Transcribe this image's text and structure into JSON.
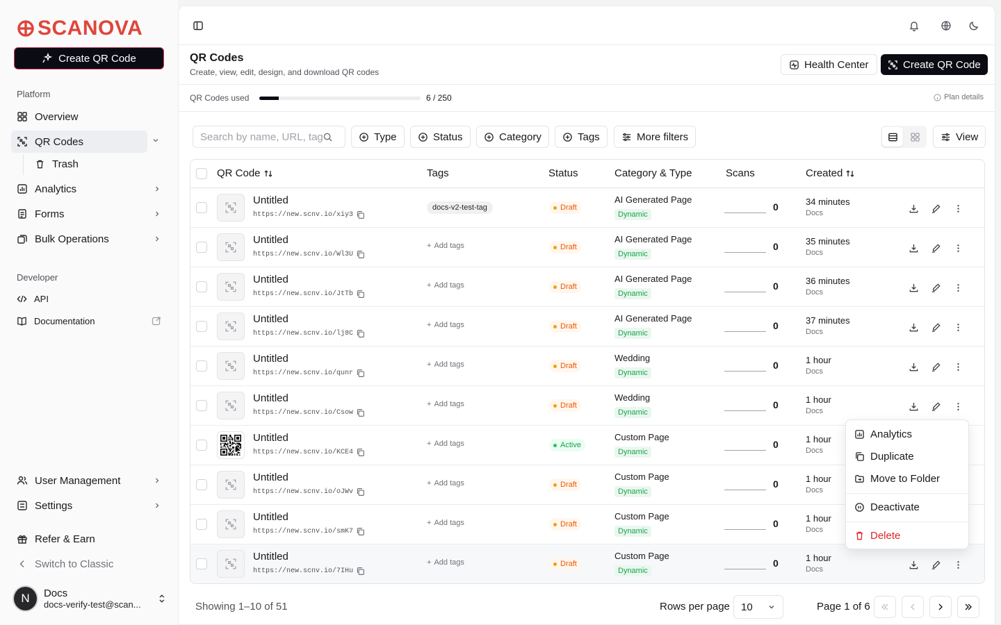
{
  "brand": {
    "name": "SCANOVA",
    "accent": "#e0453a"
  },
  "sidebar": {
    "create_label": "Create QR Code",
    "platform_label": "Platform",
    "developer_label": "Developer",
    "items": {
      "overview": "Overview",
      "qr_codes": "QR Codes",
      "trash": "Trash",
      "analytics": "Analytics",
      "forms": "Forms",
      "bulk": "Bulk Operations",
      "api": "API",
      "docs": "Documentation",
      "user_mgmt": "User Management",
      "settings": "Settings",
      "refer": "Refer & Earn",
      "switch": "Switch to Classic"
    },
    "user": {
      "initial": "N",
      "name": "Docs",
      "email": "docs-verify-test@scan..."
    }
  },
  "header": {
    "title": "QR Codes",
    "subtitle": "Create, view, edit, design, and download QR codes",
    "health_label": "Health Center",
    "create_label": "Create QR Code"
  },
  "usage": {
    "label": "QR Codes used",
    "used": 6,
    "total": 250,
    "text": "6 / 250",
    "plan_label": "Plan details"
  },
  "toolbar": {
    "search_placeholder": "Search by name, URL, tags",
    "filters": {
      "type": "Type",
      "status": "Status",
      "category": "Category",
      "tags": "Tags",
      "more": "More filters"
    },
    "view_label": "View"
  },
  "table": {
    "columns": {
      "qr": "QR Code",
      "tags": "Tags",
      "status": "Status",
      "category": "Category & Type",
      "scans": "Scans",
      "created": "Created"
    },
    "add_tags_label": "Add tags",
    "rows": [
      {
        "name": "Untitled",
        "url": "https://new.scnv.io/xiy3",
        "tag": "docs-v2-test-tag",
        "status": "Draft",
        "category": "AI Generated Page",
        "type": "Dynamic",
        "scans": "0",
        "created": "34 minutes",
        "by": "Docs",
        "qr": false
      },
      {
        "name": "Untitled",
        "url": "https://new.scnv.io/Wl3U",
        "tag": "",
        "status": "Draft",
        "category": "AI Generated Page",
        "type": "Dynamic",
        "scans": "0",
        "created": "35 minutes",
        "by": "Docs",
        "qr": false
      },
      {
        "name": "Untitled",
        "url": "https://new.scnv.io/JtTb",
        "tag": "",
        "status": "Draft",
        "category": "AI Generated Page",
        "type": "Dynamic",
        "scans": "0",
        "created": "36 minutes",
        "by": "Docs",
        "qr": false
      },
      {
        "name": "Untitled",
        "url": "https://new.scnv.io/lj8C",
        "tag": "",
        "status": "Draft",
        "category": "AI Generated Page",
        "type": "Dynamic",
        "scans": "0",
        "created": "37 minutes",
        "by": "Docs",
        "qr": false
      },
      {
        "name": "Untitled",
        "url": "https://new.scnv.io/qunr",
        "tag": "",
        "status": "Draft",
        "category": "Wedding",
        "type": "Dynamic",
        "scans": "0",
        "created": "1 hour",
        "by": "Docs",
        "qr": false
      },
      {
        "name": "Untitled",
        "url": "https://new.scnv.io/Csow",
        "tag": "",
        "status": "Draft",
        "category": "Wedding",
        "type": "Dynamic",
        "scans": "0",
        "created": "1 hour",
        "by": "Docs",
        "qr": false
      },
      {
        "name": "Untitled",
        "url": "https://new.scnv.io/KCE4",
        "tag": "",
        "status": "Active",
        "category": "Custom Page",
        "type": "Dynamic",
        "scans": "0",
        "created": "1 hour",
        "by": "Docs",
        "qr": true
      },
      {
        "name": "Untitled",
        "url": "https://new.scnv.io/oJWv",
        "tag": "",
        "status": "Draft",
        "category": "Custom Page",
        "type": "Dynamic",
        "scans": "0",
        "created": "1 hour",
        "by": "Docs",
        "qr": false
      },
      {
        "name": "Untitled",
        "url": "https://new.scnv.io/smK7",
        "tag": "",
        "status": "Draft",
        "category": "Custom Page",
        "type": "Dynamic",
        "scans": "0",
        "created": "1 hour",
        "by": "Docs",
        "qr": false
      },
      {
        "name": "Untitled",
        "url": "https://new.scnv.io/7IHu",
        "tag": "",
        "status": "Draft",
        "category": "Custom Page",
        "type": "Dynamic",
        "scans": "0",
        "created": "1 hour",
        "by": "Docs",
        "qr": false
      }
    ]
  },
  "status_colors": {
    "Draft": {
      "bg": "#fff7ed",
      "fg": "#ea580c",
      "dot": "#f59e0b"
    },
    "Active": {
      "bg": "#ecfdf3",
      "fg": "#16a34a",
      "dot": "#22c55e"
    }
  },
  "pagination": {
    "showing": "Showing 1–10 of 51",
    "rows_label": "Rows per page",
    "rows_value": "10",
    "page_label": "Page 1 of 6"
  },
  "context_menu": {
    "analytics": "Analytics",
    "duplicate": "Duplicate",
    "move": "Move to Folder",
    "deactivate": "Deactivate",
    "delete": "Delete"
  }
}
